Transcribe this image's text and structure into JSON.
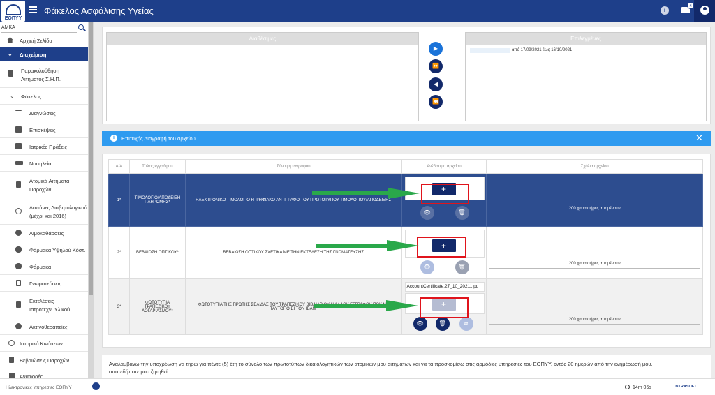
{
  "app": {
    "title": "Φάκελος Ασφάλισης Υγείας",
    "logo_text": "ΕΟΠΥΥ",
    "mail_badge": "4",
    "info_icon": "i"
  },
  "sidebar": {
    "search_label": "ΑΜΚΑ",
    "items": [
      {
        "label": "Αρχική Σελίδα",
        "icon": "home-icon"
      },
      {
        "label": "Διαχείριση",
        "icon": "chevron-down-icon"
      },
      {
        "label_l1": "Παρακολούθηση",
        "label_l2": "Αιτήματος Σ.Η.Π.",
        "icon": "document-icon"
      },
      {
        "label": "Φάκελος",
        "icon": "chevron-down-icon"
      },
      {
        "label": "Διαγνώσεις",
        "icon": "pulse-icon"
      },
      {
        "label": "Επισκέψεις",
        "icon": "doctor-icon"
      },
      {
        "label": "Ιατρικές Πράξεις",
        "icon": "medical-icon"
      },
      {
        "label": "Νοσηλεία",
        "icon": "bed-icon"
      },
      {
        "label_l1": "Ατομικά Αιτήματα",
        "label_l2": "Παροχών",
        "icon": "person-icon"
      },
      {
        "label_l1": "Δαπάνες Διαβητολογικού",
        "label_l2": "(μέχρι και 2016)",
        "icon": "wheelchair-icon"
      },
      {
        "label": "Αιμοκαθάρσεις",
        "icon": "kidney-icon"
      },
      {
        "label": "Φάρμακα Υψηλού Κόστ.",
        "icon": "pills-icon"
      },
      {
        "label": "Φάρμακα",
        "icon": "pills-icon"
      },
      {
        "label": "Γνωματεύσεις",
        "icon": "clipboard-icon"
      },
      {
        "label_l1": "Εκτελέσεις",
        "label_l2": "Ιατροτεχν. Υλικού",
        "icon": "document-icon"
      },
      {
        "label": "Ακτινοθεραπείες",
        "icon": "radiation-icon"
      },
      {
        "label": "Ιστορικό Κινήσεων",
        "icon": "history-icon"
      },
      {
        "label": "Βεβαιώσεις Παροχών",
        "icon": "document-icon"
      },
      {
        "label": "Αναφορές",
        "icon": "chart-icon"
      }
    ]
  },
  "dual_list": {
    "available_title": "Διαθέσιμες",
    "selected_title": "Επιλεγμένες",
    "selected_items": [
      "από 17/09/2021 έως 16/10/2021"
    ],
    "controls": [
      "▶",
      "⏩",
      "◀",
      "⏪"
    ]
  },
  "alert": {
    "text": "Επιτυχής Διαγραφή του αρχείου.",
    "close": "✕",
    "icon": "i"
  },
  "table": {
    "headers": [
      "Α/Α",
      "Τίτλος εγγράφου",
      "Σύνοψη εγγράφου",
      "Ανέβασμα αρχείου",
      "Σχόλια αρχείου"
    ],
    "rows": [
      {
        "num": "1*",
        "title_l1": "ΤΙΜΟΛΟΓΙΟ/ΑΠΟΔΕΙΞΗ",
        "title_l2": "ΠΛΗΡΩΜΗΣ*",
        "summary": "ΗΛΕΚΤΡΟΝΙΚΟ ΤΙΜΟΛΟΓΙΟ Η ΨΗΦΙΑΚΟ ΑΝΤΙΓΡΑΦΟ ΤΟΥ ΠΡΩΤΟΤΥΠΟΥ ΤΙΜΟΛΟΓΙΟΥ/ΑΠΟΔΕΙΞΗΣ",
        "comment": "200 χαρακτήρες απομένουν",
        "plus": "+"
      },
      {
        "num": "2*",
        "title_l1": "ΒΕΒΑΙΩΣΗ ΟΠΤΙΚΟΥ*",
        "summary": "ΒΕΒΑΙΩΣΗ ΟΠΤΙΚΟΥ ΣΧΕΤΙΚΑ ΜΕ ΤΗΝ ΕΚΤΕΛΕΣΗ ΤΗΣ ΓΝΩΜΑΤΕΥΣΗΣ",
        "comment": "200 χαρακτήρες απομένουν",
        "plus": "+"
      },
      {
        "num": "3*",
        "title_l1": "ΦΩΤΟΤΥΠΙΑ",
        "title_l2": "ΤΡΑΠΕΖΙΚΟΥ",
        "title_l3": "ΛΟΓΑΡΙΑΣΜΟΥ*",
        "summary_l1": "ΦΩΤΟΤΥΠΙΑ ΤΗΣ ΠΡΩΤΗΣ ΣΕΛΙΔΑΣ ΤΟΥ ΤΡΑΠΕΖΙΚΟΥ ΒΙΒΛΙΑΡΙΟΥ Η ΑΛΛΟΥ ΕΓΓΡΑΦΟΥ ΠΟΥ ΝΑ",
        "summary_l2": "ΤΑΥΤΟΠΟΙΕΙ ΤΟΝ IBAN.",
        "filename": "AccountCertificate.27_10_20211.pd",
        "comment": "200 χαρακτήρες απομένουν",
        "plus": "+"
      }
    ]
  },
  "notice": {
    "line1": "Αναλαμβάνω την υποχρέωση να τηρώ για πέντε (5) έτη το σύνολο των πρωτοτύπων δικαιολογητικών των ατομικών μου αιτημάτων και να τα προσκομίσω στις αρμόδιες υπηρεσίες του ΕΟΠΥΥ, εντός 20 ημερών από την ενημέρωσή μου,",
    "line2": "οποτεδήποτε μου ζητηθεί."
  },
  "footer": {
    "text": "Ηλεκτρονικές Υπηρεσίες ΕΟΠΥΥ",
    "timer": "14m 05s",
    "brand": "INTRASOFT",
    "info": "i"
  },
  "colors": {
    "primary": "#1e3f8a",
    "accent": "#2f9bf0",
    "arrow": "#2aa84a",
    "highlight": "#e0141c"
  }
}
